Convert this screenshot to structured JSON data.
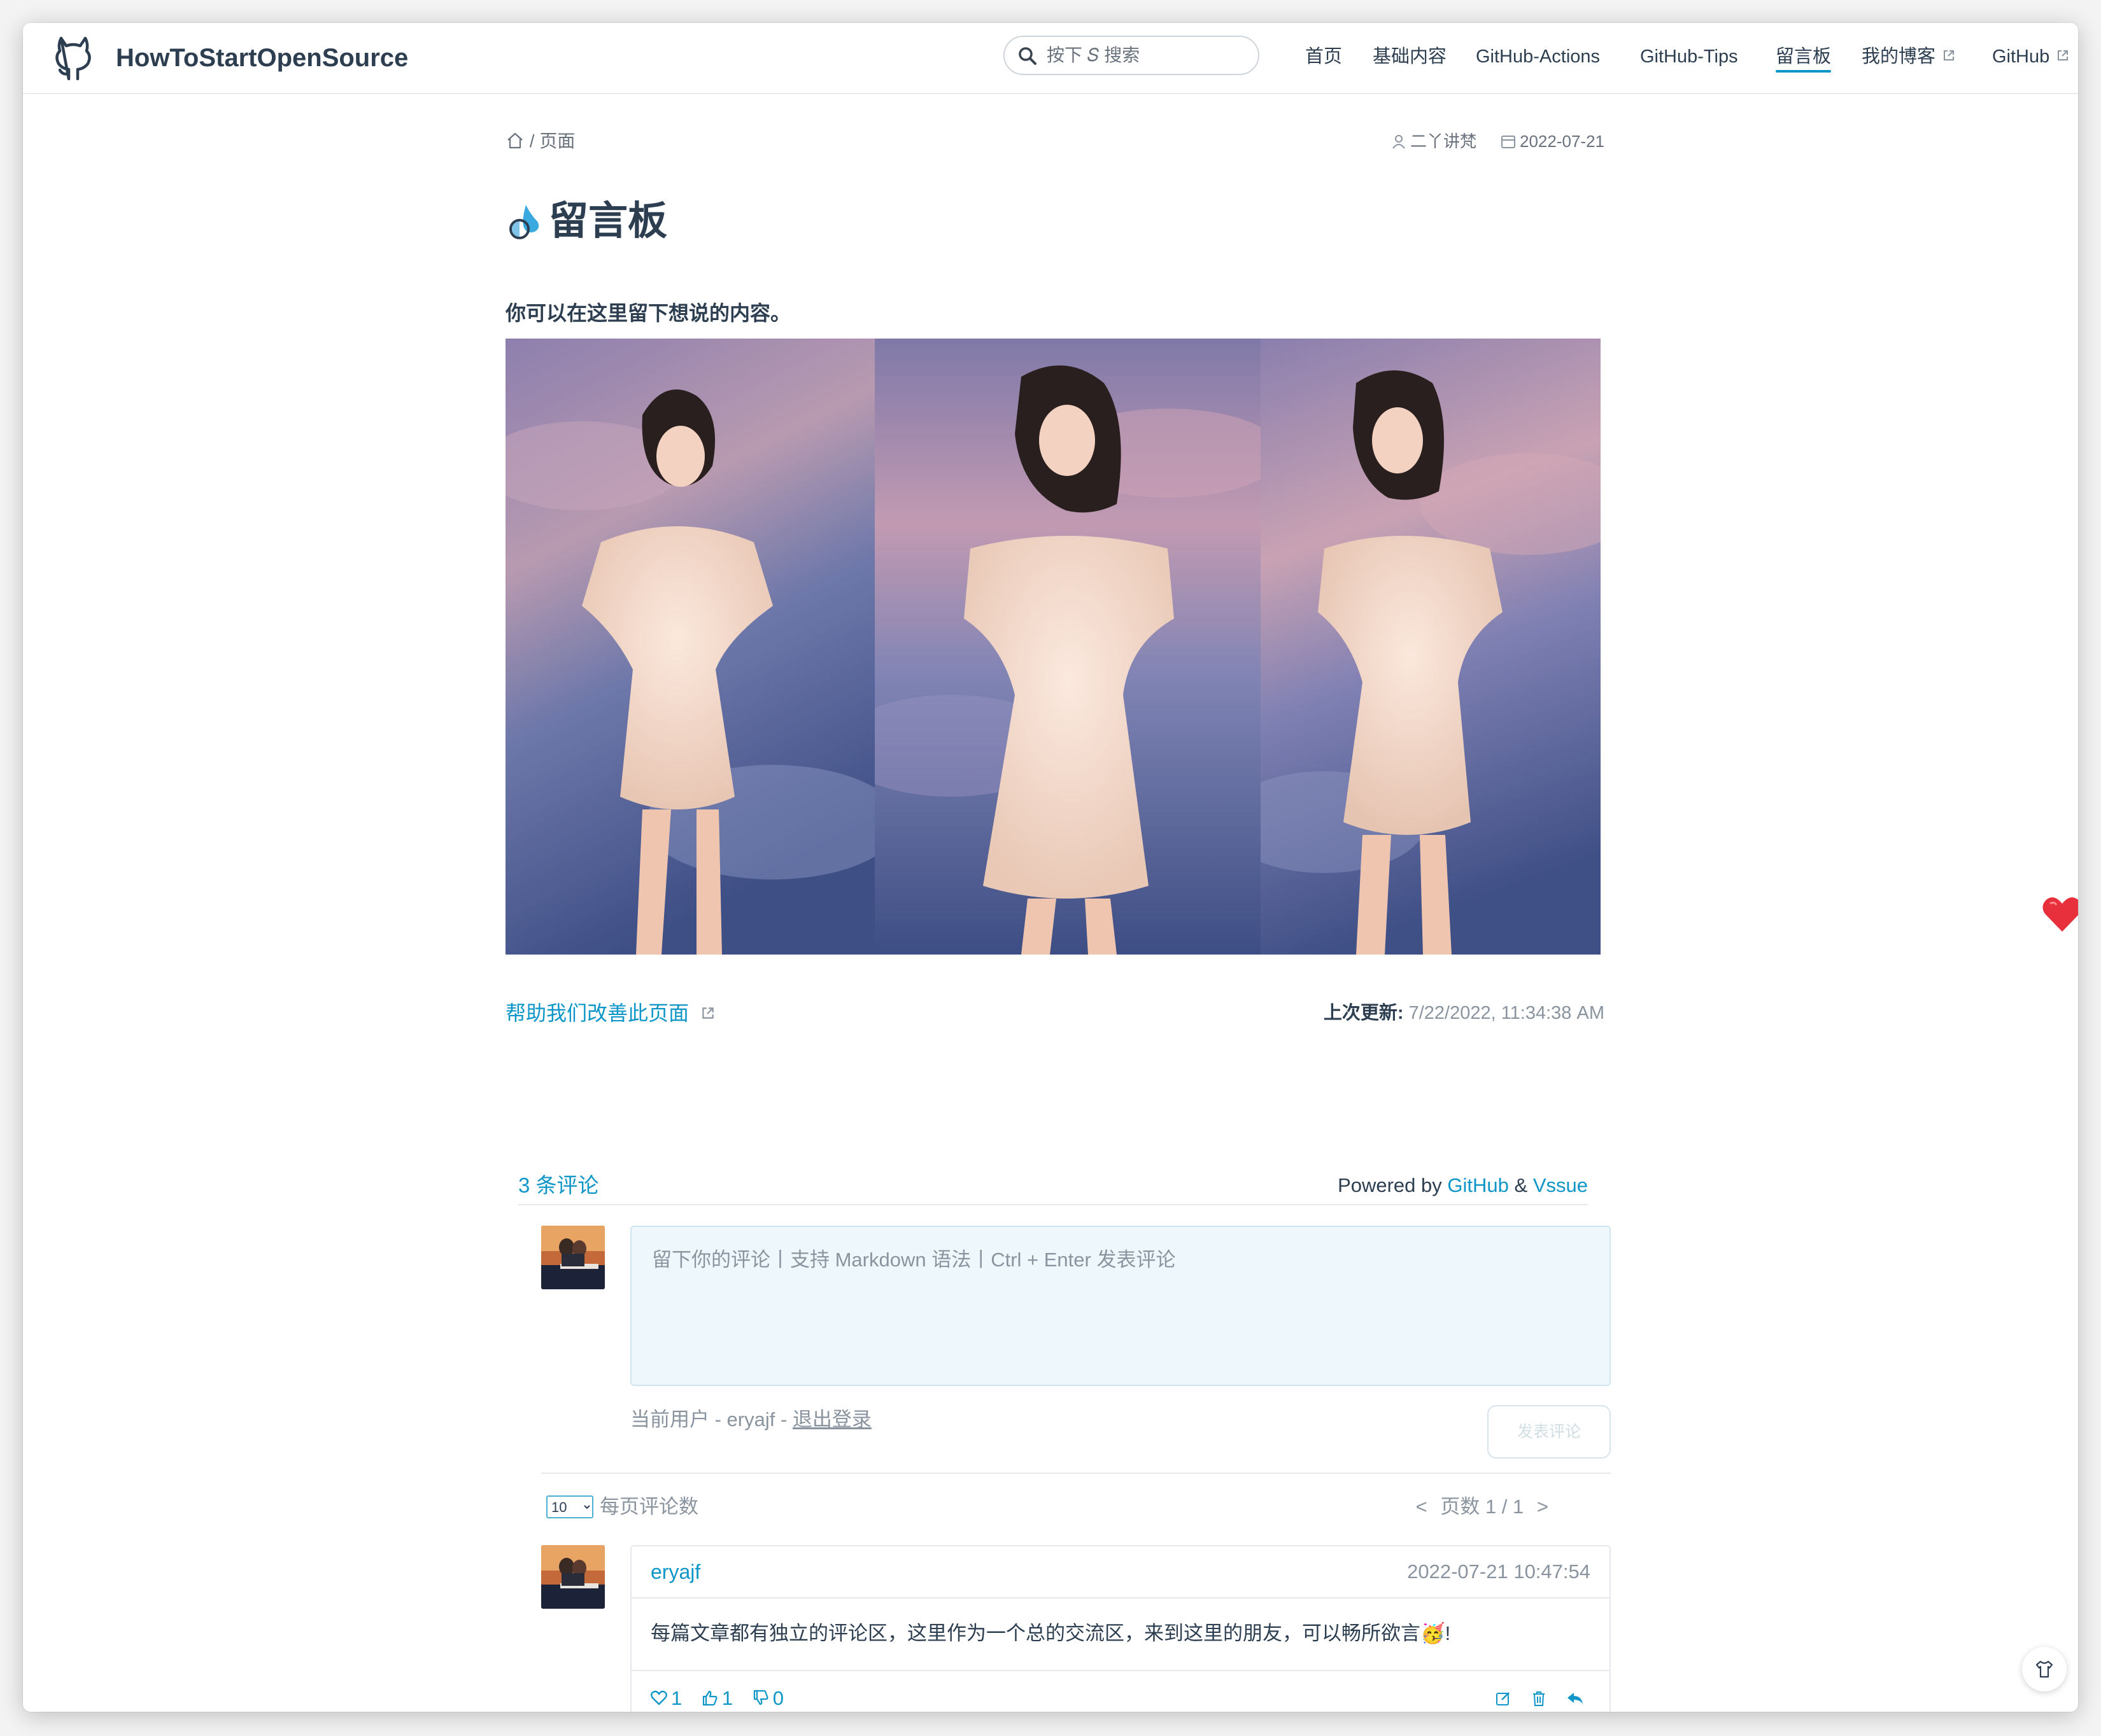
{
  "navbar": {
    "site_name": "HowToStartOpenSource",
    "search_placeholder": "按下 𝑆 搜索",
    "items": [
      {
        "label": "首页"
      },
      {
        "label": "基础内容"
      },
      {
        "label": "GitHub-Actions"
      },
      {
        "label": "GitHub-Tips"
      },
      {
        "label": "留言板",
        "active": true
      },
      {
        "label": "我的博客",
        "external": true
      },
      {
        "label": "GitHub",
        "external": true
      }
    ]
  },
  "breadcrumb": {
    "separator": "/",
    "current": "页面"
  },
  "meta": {
    "author": "二丫讲梵",
    "date": "2022-07-21"
  },
  "page": {
    "title": "留言板",
    "intro": "你可以在这里留下想说的内容。"
  },
  "footer_links": {
    "edit_link": "帮助我们改善此页面",
    "last_updated_label": "上次更新:",
    "last_updated_value": "7/22/2022, 11:34:38 AM"
  },
  "comments": {
    "count_label": "3 条评论",
    "powered_by": "Powered by",
    "github": "GitHub",
    "amp": "&",
    "vssue": "Vssue",
    "editor_placeholder": "留下你的评论丨支持 Markdown 语法丨Ctrl + Enter 发表评论",
    "current_user_prefix": "当前用户 - eryajf - ",
    "logout": "退出登录",
    "submit_label": "发表评论",
    "per_page_value": "10",
    "per_page_label": "每页评论数",
    "pager_prev": "<",
    "pager_text": "页数 1 / 1",
    "pager_next": ">",
    "items": [
      {
        "author": "eryajf",
        "time": "2022-07-21 10:47:54",
        "body": "每篇文章都有独立的评论区，这里作为一个总的交流区，来到这里的朋友，可以畅所欲言🥳!",
        "likes": "1",
        "thumbs_up": "1",
        "thumbs_down": "0"
      }
    ]
  },
  "colors": {
    "accent": "#0e96c8",
    "text": "#2c3e50",
    "muted": "#8a949f",
    "editor_bg": "#eef8fc"
  },
  "icons": [
    "github-logo-icon",
    "search-icon",
    "external-link-icon",
    "home-icon",
    "user-icon",
    "calendar-icon",
    "title-emoji-icon",
    "heart-icon",
    "thumbs-up-icon",
    "thumbs-down-icon",
    "edit-icon",
    "delete-icon",
    "reply-icon",
    "theme-shirt-icon"
  ]
}
